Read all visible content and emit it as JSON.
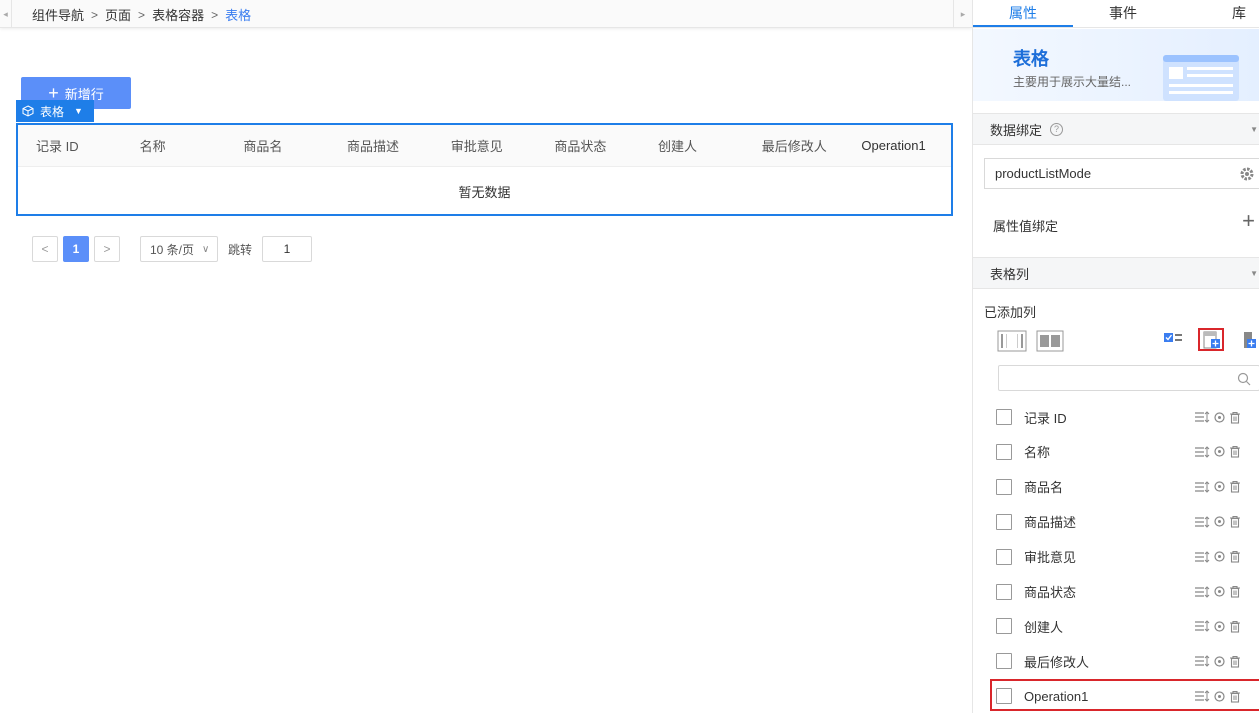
{
  "breadcrumb": [
    "组件导航",
    "页面",
    "表格容器",
    "表格"
  ],
  "canvas": {
    "add_row_label": "新增行",
    "table_tag_label": "表格",
    "columns": [
      "记录 ID",
      "名称",
      "商品名",
      "商品描述",
      "审批意见",
      "商品状态",
      "创建人",
      "最后修改人",
      "Operation1"
    ],
    "empty_text": "暂无数据",
    "pager": {
      "current_page": "1",
      "page_size": "10 条/页",
      "jump_label": "跳转",
      "jump_value": "1"
    }
  },
  "panel": {
    "tabs": [
      "属性",
      "事件",
      "库"
    ],
    "active_tab": "属性",
    "hero": {
      "title": "表格",
      "desc": "主要用于展示大量结..."
    },
    "data_binding": {
      "section_title": "数据绑定",
      "source": "productListMode",
      "attr_binding_label": "属性值绑定"
    },
    "table_columns": {
      "section_title": "表格列",
      "added_label": "已添加列",
      "search_placeholder": "",
      "items": [
        "记录 ID",
        "名称",
        "商品名",
        "商品描述",
        "审批意见",
        "商品状态",
        "创建人",
        "最后修改人",
        "Operation1"
      ]
    }
  },
  "colors": {
    "accent": "#1e7ee8",
    "button": "#5b8ff9",
    "highlight": "#d9262b"
  }
}
